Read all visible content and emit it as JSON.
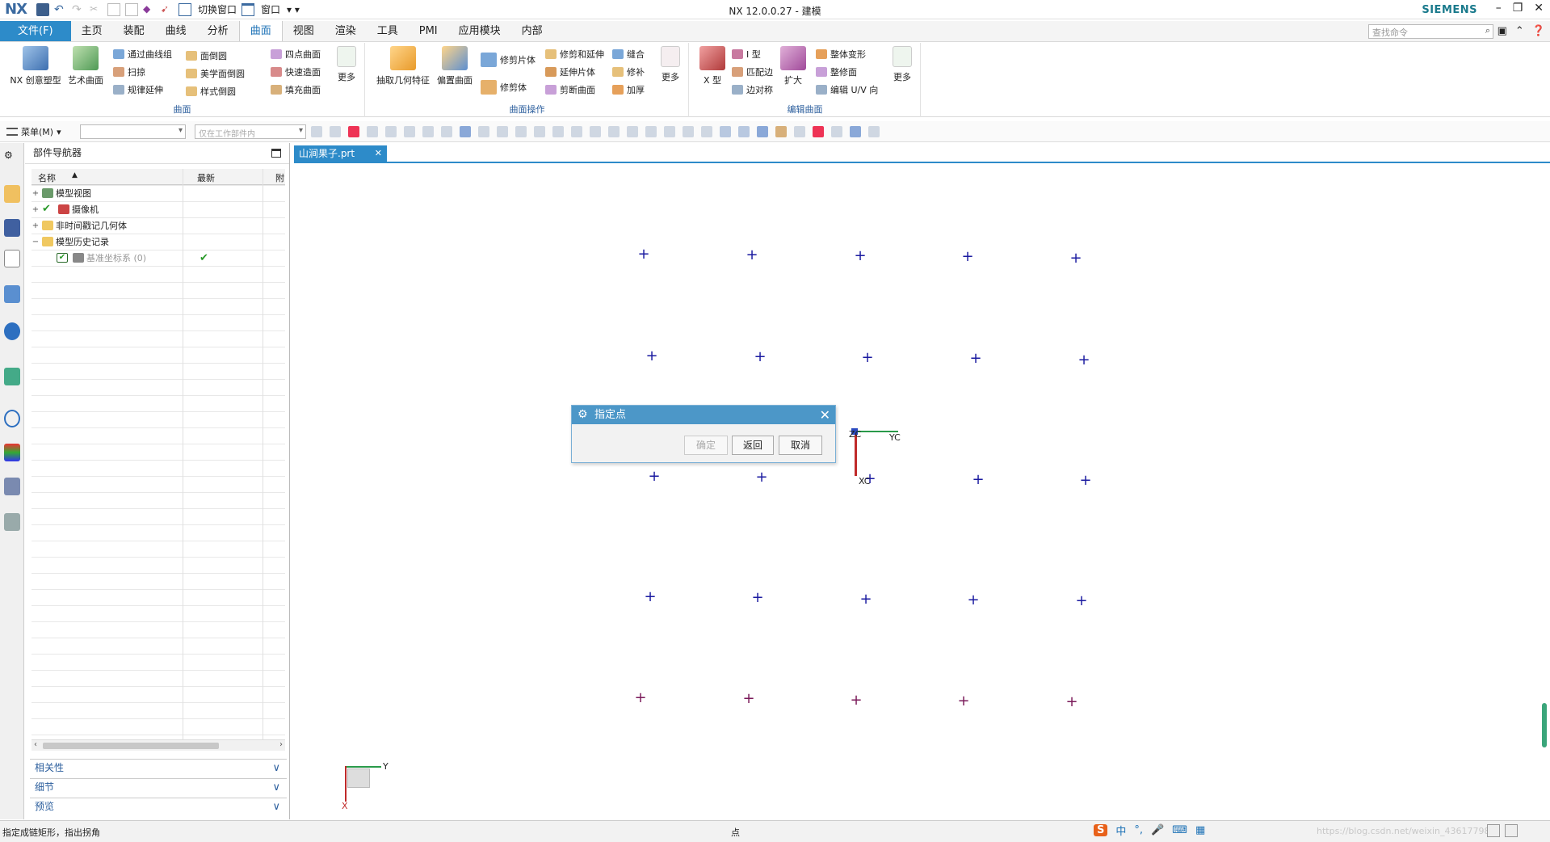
{
  "app": {
    "logo": "NX",
    "window_title": "NX 12.0.0.27 - 建模",
    "brand": "SIEMENS",
    "switch_window": "切换窗口",
    "window_menu": "窗口"
  },
  "menu_tabs": [
    "文件(F)",
    "主页",
    "装配",
    "曲线",
    "分析",
    "曲面",
    "视图",
    "渲染",
    "工具",
    "PMI",
    "应用模块",
    "内部"
  ],
  "active_tab": "曲面",
  "search_command": {
    "placeholder": "查找命令"
  },
  "ribbon": {
    "group_surface": {
      "label": "曲面",
      "big": [
        "NX 创意塑型",
        "艺术曲面"
      ],
      "small_col1": [
        "通过曲线组",
        "扫掠",
        "规律延伸"
      ],
      "small_col2": [
        "面倒圆",
        "美学面倒圆",
        "样式倒圆"
      ],
      "small_col3": [
        "四点曲面",
        "快速造面",
        "填充曲面"
      ],
      "more": "更多"
    },
    "group_surface_ops": {
      "label": "曲面操作",
      "big": [
        "抽取几何特征",
        "偏置曲面"
      ],
      "small_col1": [
        "修剪片体",
        "修剪体"
      ],
      "small_col2": [
        "修剪和延伸",
        "延伸片体",
        "剪断曲面"
      ],
      "small_col3": [
        "缝合",
        "修补",
        "加厚"
      ],
      "more": "更多"
    },
    "group_edit_surface": {
      "label": "编辑曲面",
      "big": [
        "X 型",
        "扩大"
      ],
      "small_col1": [
        "I 型",
        "匹配边",
        "边对称"
      ],
      "small_col2": [
        "整体变形",
        "整修面",
        "编辑 U/V 向"
      ],
      "more": "更多"
    }
  },
  "toolbar2": {
    "menu_label": "菜单(M)",
    "filter_combo": "",
    "scope_combo": "仅在工作部件内"
  },
  "navigator": {
    "title": "部件导航器",
    "columns": [
      "名称",
      "最新",
      "附"
    ],
    "rows": [
      {
        "label": "模型视图",
        "expander": "+",
        "latest": ""
      },
      {
        "label": "摄像机",
        "expander": "+",
        "latest": ""
      },
      {
        "label": "非时间戳记几何体",
        "expander": "+",
        "latest": ""
      },
      {
        "label": "模型历史记录",
        "expander": "−",
        "latest": ""
      },
      {
        "label": "基准坐标系 (0)",
        "expander": "",
        "latest": "✔"
      }
    ],
    "panels": [
      "相关性",
      "细节",
      "预览"
    ]
  },
  "graphics": {
    "tab_label": "山涧果子.prt",
    "wcs_labels": {
      "zc": "ZC",
      "yc": "YC",
      "xc": "XC"
    },
    "abs_labels": {
      "y": "Y",
      "x": "X"
    }
  },
  "dialog": {
    "title": "指定点",
    "buttons": {
      "ok": "确定",
      "back": "返回",
      "cancel": "取消"
    }
  },
  "status": {
    "prompt": "指定成链矩形，指出拐角",
    "mid": "点",
    "ime": "中",
    "watermark": "https://blog.csdn.net/weixin_43617798"
  },
  "colors": {
    "accent": "#2d8bc9",
    "dialog_header": "#4c97c8",
    "point_marker": "#1a1aa0",
    "brand": "#1a7a8c"
  }
}
